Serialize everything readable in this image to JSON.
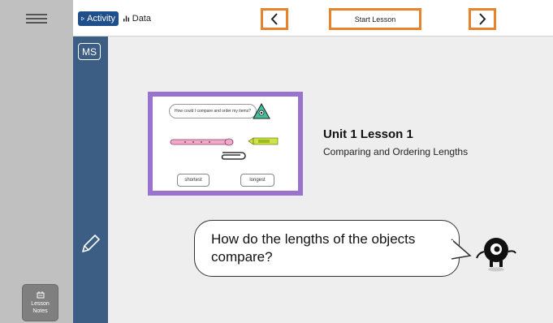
{
  "topbar": {
    "tabs": [
      {
        "label": "Activity",
        "icon": "play-outline-icon",
        "active": true
      },
      {
        "label": "Data",
        "icon": "bar-chart-icon",
        "active": false
      }
    ],
    "start_lesson_label": "Start Lesson"
  },
  "sidebar": {
    "badge": "MS",
    "lesson_notes_label": "Lesson\nNotes"
  },
  "card": {
    "question": "How could I compare and order my items?",
    "shortest_label": "shortest",
    "longest_label": "longest"
  },
  "lesson": {
    "title": "Unit 1 Lesson 1",
    "subtitle": "Comparing and Ordering Lengths"
  },
  "prompt": {
    "text": "How do the lengths of the objects compare?"
  },
  "colors": {
    "accent_orange": "#e8832b",
    "sidebar_blue": "#3c5d84",
    "card_purple": "#9a73cf",
    "tab_active": "#1f4f8a"
  }
}
